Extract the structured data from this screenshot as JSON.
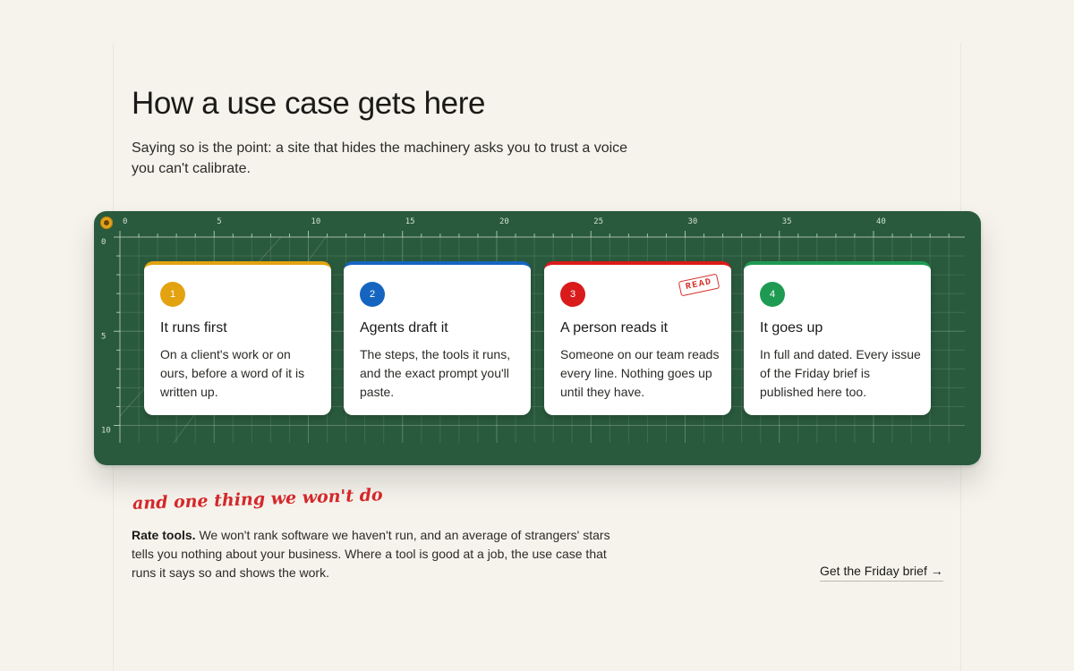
{
  "heading": "How a use case gets here",
  "lede": "Saying so is the point: a site that hides the machinery asks you to trust a voice you can't calibrate.",
  "ruler": {
    "top_ticks": [
      "0",
      "5",
      "10",
      "15",
      "20",
      "25",
      "30",
      "35",
      "40"
    ],
    "side_ticks": [
      "0",
      "5",
      "10"
    ]
  },
  "steps": [
    {
      "number": "1",
      "title": "It runs first",
      "body": "On a client's work or on ours, before a word of it is written up.",
      "color": "#e3a20f"
    },
    {
      "number": "2",
      "title": "Agents draft it",
      "body": "The steps, the tools it runs, and the exact prompt you'll paste.",
      "color": "#1565c0"
    },
    {
      "number": "3",
      "title": "A person reads it",
      "body": "Someone on our team reads every line. Nothing goes up until they have.",
      "color": "#d91b1b",
      "stamp": "READ"
    },
    {
      "number": "4",
      "title": "It goes up",
      "body": "In full and dated. Every issue of the Friday brief is published here too.",
      "color": "#1f9a52"
    }
  ],
  "aside": {
    "handwritten": "and one thing we won't do",
    "lead": "Rate tools.",
    "text": " We won't rank software we haven't run, and an average of strangers' stars tells you nothing about your business. Where a tool is good at a job, the use case that runs it says so and shows the work."
  },
  "cta": {
    "label": "Get the Friday brief",
    "arrow": "→"
  },
  "colors": {
    "mat": "#2a5a3d",
    "background": "#f6f3ec",
    "accent_red": "#d4272b"
  }
}
